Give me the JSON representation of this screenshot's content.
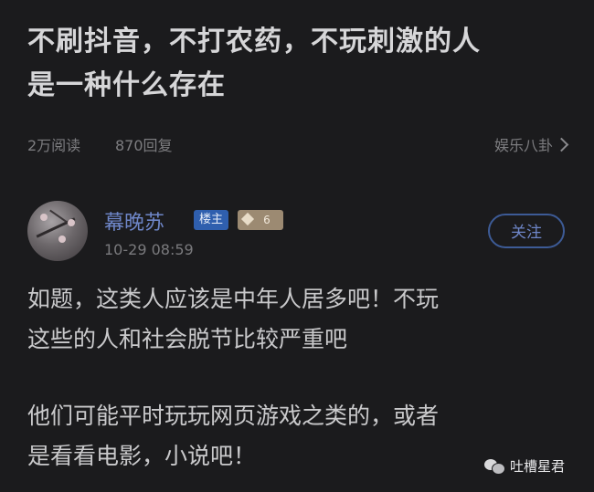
{
  "post": {
    "title_line1": "不刷抖音，不打农药，不玩刺激的人",
    "title_line2": "是一种什么存在",
    "reads": "2万阅读",
    "replies": "870回复",
    "category": "娱乐八卦"
  },
  "author": {
    "name": "幕晚苏",
    "host_badge": "楼主",
    "level": "6",
    "timestamp": "10-29 08:59",
    "follow_label": "关注"
  },
  "content": {
    "para1_line1": "如题，这类人应该是中年人居多吧！不玩",
    "para1_line2": "这些的人和社会脱节比较严重吧",
    "para2_line1": "他们可能平时玩玩网页游戏之类的，或者",
    "para2_line2": "是看看电影，小说吧！"
  },
  "watermark": {
    "text": "吐槽星君"
  },
  "colors": {
    "background": "#1b1b1d",
    "accent_blue": "#6e86c8",
    "host_badge": "#2f5fae",
    "level_badge": "#9c8a72"
  },
  "icons": [
    "chevron-right-icon",
    "avatar",
    "level-gem-icon",
    "wechat-icon"
  ]
}
